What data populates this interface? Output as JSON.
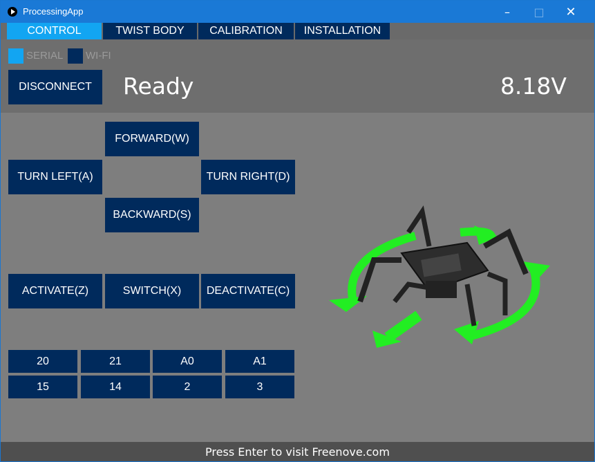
{
  "window": {
    "title": "ProcessingApp"
  },
  "tabs": [
    "CONTROL",
    "TWIST BODY",
    "CALIBRATION",
    "INSTALLATION"
  ],
  "connection": {
    "serial_label": "SERIAL",
    "wifi_label": "WI-FI",
    "disconnect_label": "DISCONNECT",
    "status": "Ready",
    "voltage": "8.18V"
  },
  "movement": {
    "forward": "FORWARD(W)",
    "turn_left": "TURN LEFT(A)",
    "turn_right": "TURN RIGHT(D)",
    "backward": "BACKWARD(S)"
  },
  "actions": {
    "activate": "ACTIVATE(Z)",
    "switch": "SWITCH(X)",
    "deactivate": "DEACTIVATE(C)"
  },
  "pins": {
    "row1": [
      "20",
      "21",
      "A0",
      "A1"
    ],
    "row2": [
      "15",
      "14",
      "2",
      "3"
    ]
  },
  "footer": "Press Enter to visit Freenove.com",
  "colors": {
    "titlebar": "#1a79d6",
    "button": "#002a5c",
    "tab_active": "#12a5f2",
    "arrow": "#22ee22"
  },
  "icons": {
    "app": "play-circle-icon",
    "minimize": "minimize-icon",
    "maximize": "maximize-icon",
    "close": "close-icon"
  }
}
